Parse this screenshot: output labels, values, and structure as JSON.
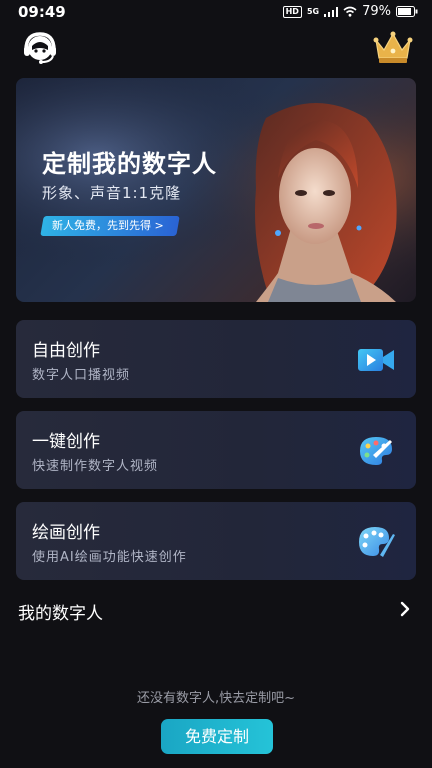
{
  "status": {
    "time": "09:49",
    "hd": "HD",
    "network": "5G",
    "battery": "79%"
  },
  "banner": {
    "title": "定制我的数字人",
    "subtitle": "形象、声音1:1克隆",
    "tag": "新人免费，先到先得 >"
  },
  "cards": [
    {
      "title": "自由创作",
      "subtitle": "数字人口播视频",
      "icon": "video-camera-icon"
    },
    {
      "title": "一键创作",
      "subtitle": "快速制作数字人视频",
      "icon": "palette-icon"
    },
    {
      "title": "绘画创作",
      "subtitle": "使用AI绘画功能快速创作",
      "icon": "palette-brush-icon"
    }
  ],
  "my_digital_humans": {
    "title": "我的数字人"
  },
  "empty_state": {
    "hint": "还没有数字人,快去定制吧~",
    "button": "免费定制"
  },
  "colors": {
    "accent": "#1fb3cc",
    "card_bg": "#262a3c",
    "page_bg": "#101014"
  }
}
